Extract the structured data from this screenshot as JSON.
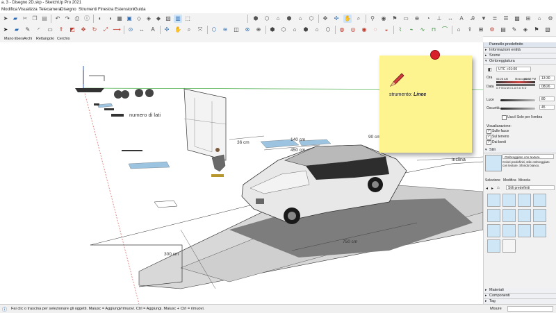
{
  "window": {
    "title": "a. 3 - Disegno 2D.skp - SketchUp Pro 2021"
  },
  "menu": [
    "Modifica",
    "Visualizza",
    "Telecamera",
    "Disegno",
    "Strumenti",
    "Finestra",
    "Estensioni",
    "Guida"
  ],
  "drawing_toolbar": [
    "Mano libera",
    "Archi",
    "Rettangolo",
    "Cerchio"
  ],
  "sticky_note": {
    "prefix": "strumento: ",
    "tool": "Linee"
  },
  "scene_labels": {
    "sides": "numero di lati",
    "dim_36": "36 cm",
    "dim_140": "140 cm",
    "dim_450": "450 cm",
    "dim_300": "300 cm",
    "dim_750": "750 cm",
    "incline": "inclina",
    "dim_90": "90 cm"
  },
  "tray": {
    "header": "Pannello predefinito",
    "entity_info": "Informazioni entità",
    "scenes": "Scene",
    "shadows": "Ombreggiatura",
    "utc": "UTC +01:00",
    "time_label": "Ora",
    "time_start": "06:28 AM",
    "time_noon": "Mezzogiorno",
    "time_end": "06:57 PM",
    "time_value": "13:30",
    "date_label": "Data",
    "months": "G F M A M G L A S O N D",
    "date_value": "08/26",
    "light_label": "Luce",
    "light_value": "80",
    "dark_label": "Oscurità",
    "dark_value": "45",
    "use_sun": "Usa il Sole per l'ombra",
    "display_label": "Visualizzazione:",
    "on_faces": "Sulle facce",
    "on_ground": "Sul terreno",
    "from_edges": "Dai bordi",
    "styles": "Stili",
    "style_name": "Ombreggiato con texture",
    "style_desc": "Colori predefiniti, stile ombreggiato con texture. Sfondo bianco.",
    "tab_select": "Selezione",
    "tab_edit": "Modifica",
    "tab_mix": "Miscela",
    "collection": "Stili predefiniti",
    "materials": "Materiali",
    "components": "Componenti",
    "tags": "Tag"
  },
  "status": {
    "hint": "Fai clic o trascina per selezionare gli oggetti. Maiusc = Aggiungi/rimuovi. Ctrl = Aggiungi. Maiusc + Ctrl = rimuovi.",
    "measures": "Misure"
  },
  "colors": {
    "note": "#fdf48f",
    "pin": "#d8202a",
    "tray_header": "#dfe5ee"
  }
}
